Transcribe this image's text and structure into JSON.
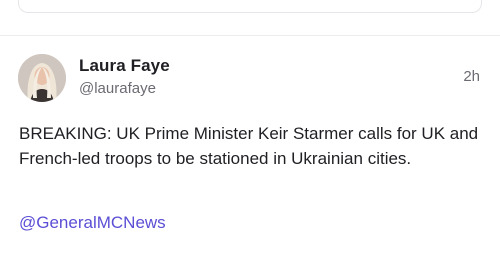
{
  "post": {
    "author": {
      "display_name": "Laura Faye",
      "handle": "@laurafaye"
    },
    "timestamp": "2h",
    "text": "BREAKING: UK Prime Minister Keir Starmer calls for UK and French-led troops to be stationed in Ukrainian cities.",
    "mention": "@GeneralMCNews"
  },
  "colors": {
    "text": "#1f1f24",
    "muted": "#6b6b73",
    "link": "#5b4fd6",
    "divider": "#ececef"
  }
}
